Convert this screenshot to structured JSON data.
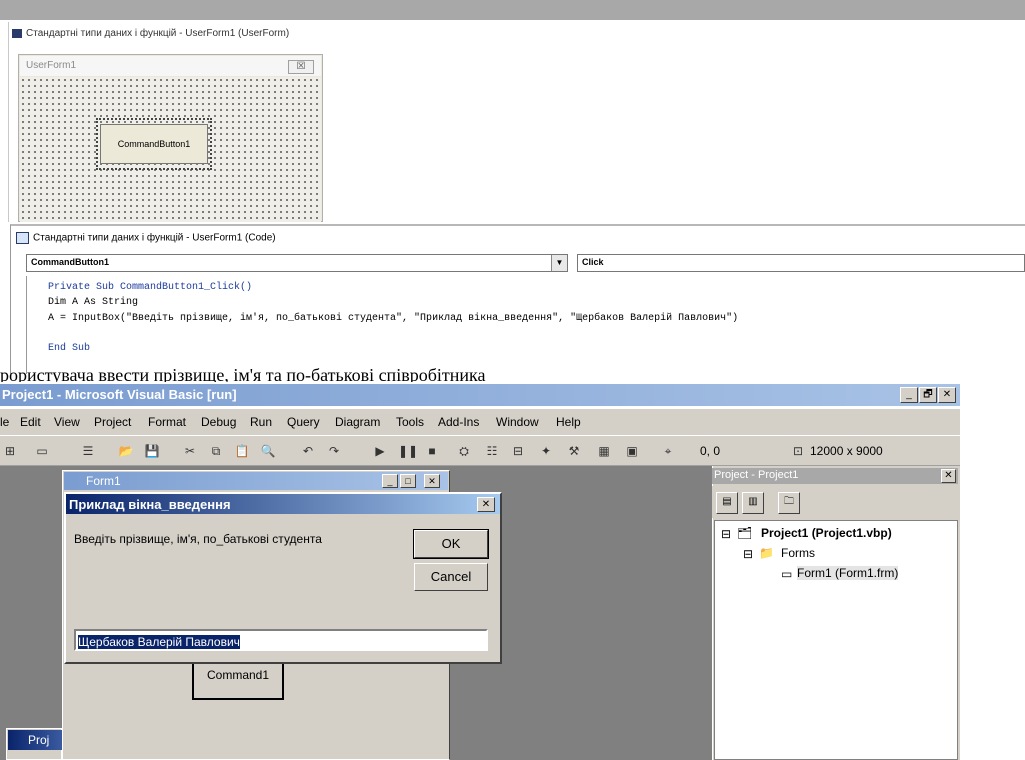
{
  "vba_form_window": {
    "title": "Стандартні типи даних і функцій - UserForm1 (UserForm)",
    "userform_title": "UserForm1",
    "close": "☒",
    "button_label": "CommandButton1"
  },
  "code_window": {
    "title": "Стандартні типи даних і функцій - UserForm1 (Code)",
    "object_combo": "CommandButton1",
    "proc_combo": "Click",
    "lines": [
      "Private Sub CommandButton1_Click()",
      "Dim A As String",
      "A = InputBox(\"Введіть прізвище, ім'я, по_батькові студента\", \"Приклад вікна_введення\", \"Щербаков Валерій Павлович\")",
      "End Sub"
    ]
  },
  "partial_text": "рористувача ввести прізвище, ім'я та по-батькові співробітника",
  "vb_window": {
    "title": "Project1 - Microsoft Visual Basic [run]",
    "window_controls": [
      "_",
      "🗗",
      "✕"
    ],
    "menu": [
      "le",
      "Edit",
      "View",
      "Project",
      "Format",
      "Debug",
      "Run",
      "Query",
      "Diagram",
      "Tools",
      "Add-Ins",
      "Window",
      "Help"
    ],
    "toolbar_position": "0, 0",
    "toolbar_size": "12000 x 9000"
  },
  "project_panel": {
    "title": "Project - Project1",
    "close": "✕",
    "tree": {
      "project": "Project1 (Project1.vbp)",
      "folder": "Forms",
      "form": "Form1 (Form1.frm)"
    }
  },
  "form1": {
    "title": "Form1",
    "controls": [
      "_",
      "□",
      "✕"
    ],
    "command_label": "Command1"
  },
  "input_dialog": {
    "title": "Приклад вікна_введення",
    "close": "✕",
    "prompt": "Введіть прізвище, ім'я, по_батькові студента",
    "ok_label": "OK",
    "cancel_label": "Cancel",
    "value": "Щербаков Валерій Павлович"
  },
  "project_small": {
    "title": "Proj"
  }
}
